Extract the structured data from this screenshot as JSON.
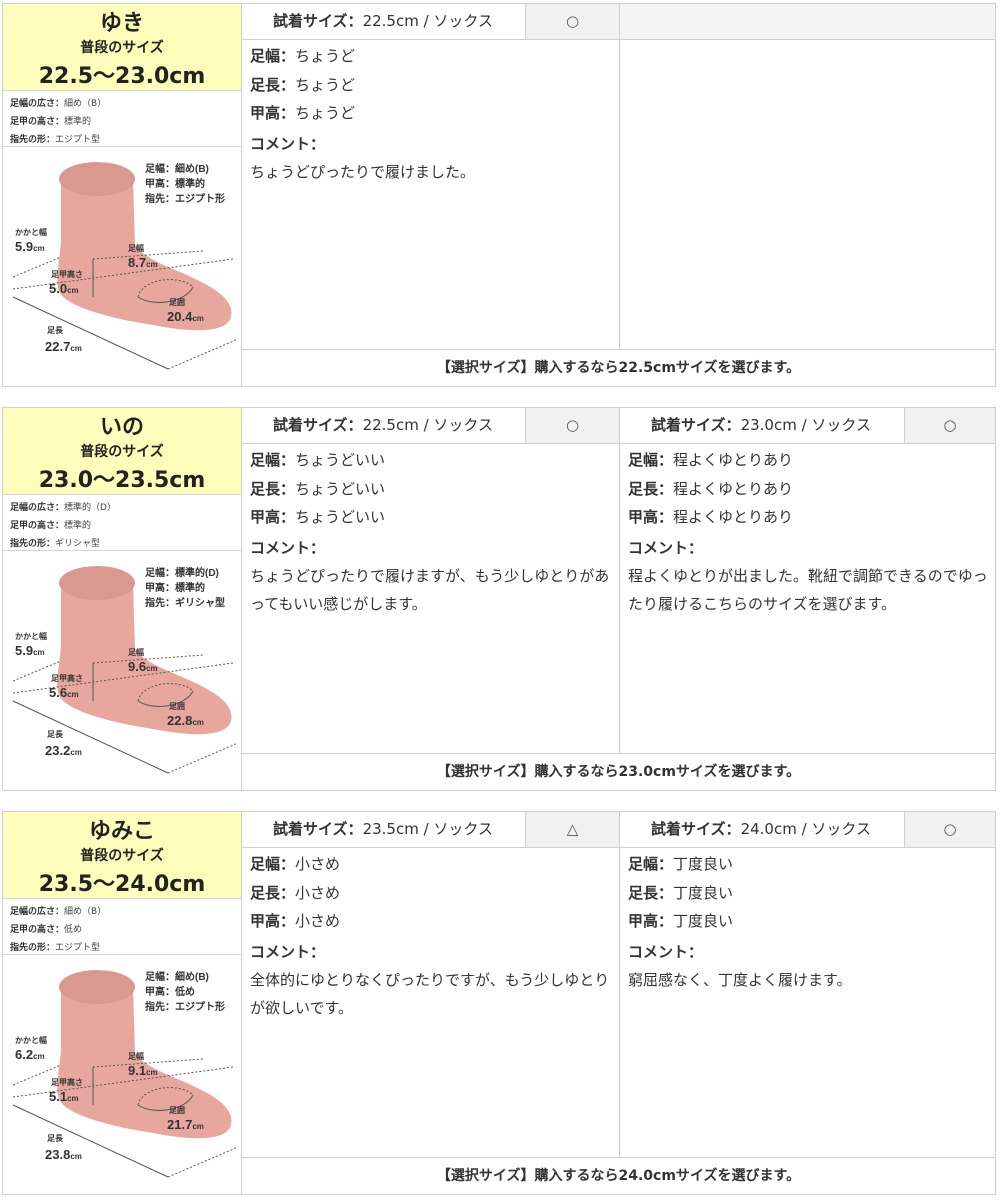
{
  "section_label": "普段のサイズ",
  "field_labels": {
    "size_label": "試着サイズ：",
    "width": "足幅：",
    "length": "足長：",
    "instep": "甲高：",
    "comment": "コメント："
  },
  "trait_labels": {
    "width": "足幅の広さ：",
    "instep": "足甲の高さ：",
    "toe": "指先の形："
  },
  "diagram_labels": {
    "heel": "かかと幅",
    "width": "足幅",
    "instep": "足甲高さ",
    "girth": "足囲",
    "length": "足長",
    "unit": "cm",
    "note_width": "足幅：",
    "note_instep": "甲高：",
    "note_toe": "指先："
  },
  "colors": {
    "highlight": "#fefdbb",
    "foot": "#e8a79e",
    "ankle": "#d99890"
  },
  "reviewers": [
    {
      "name": "ゆき",
      "usual_size": "22.5〜23.0cm",
      "traits": {
        "width": "細め（B）",
        "instep": "標準的",
        "toe": "エジプト型"
      },
      "diagram": {
        "note_width": "細め(B)",
        "note_instep": "標準的",
        "note_toe": "エジプト形",
        "heel": "5.9",
        "width": "8.7",
        "instep": "5.0",
        "girth": "20.4",
        "length": "22.7"
      },
      "fittings": [
        {
          "size": "22.5cm / ソックス",
          "rating": "○",
          "width": "ちょうど",
          "length": "ちょうど",
          "instep": "ちょうど",
          "comment": "ちょうどぴったりで履けました。"
        }
      ],
      "selection": "【選択サイズ】購入するなら22.5cmサイズを選びます。"
    },
    {
      "name": "いの",
      "usual_size": "23.0〜23.5cm",
      "traits": {
        "width": "標準的（D）",
        "instep": "標準的",
        "toe": "ギリシャ型"
      },
      "diagram": {
        "note_width": "標準的(D)",
        "note_instep": "標準的",
        "note_toe": "ギリシャ型",
        "heel": "5.9",
        "width": "9.6",
        "instep": "5.6",
        "girth": "22.8",
        "length": "23.2"
      },
      "fittings": [
        {
          "size": "22.5cm / ソックス",
          "rating": "○",
          "width": "ちょうどいい",
          "length": "ちょうどいい",
          "instep": "ちょうどいい",
          "comment_lines": [
            "ちょうどぴったりで履けますが、もう少しゆとりがあ",
            "ってもいい感じがします。"
          ]
        },
        {
          "size": "23.0cm / ソックス",
          "rating": "○",
          "width": "程よくゆとりあり",
          "length": "程よくゆとりあり",
          "instep": "程よくゆとりあり",
          "comment_lines": [
            "程よくゆとりが出ました。靴紐で調節できるのでゆっ",
            "たり履けるこちらのサイズを選びます。"
          ]
        }
      ],
      "selection": "【選択サイズ】購入するなら23.0cmサイズを選びます。"
    },
    {
      "name": "ゆみこ",
      "usual_size": "23.5〜24.0cm",
      "traits": {
        "width": "細め（B）",
        "instep": "低め",
        "toe": "エジプト型"
      },
      "diagram": {
        "note_width": "細め(B)",
        "note_instep": "低め",
        "note_toe": "エジプト形",
        "heel": "6.2",
        "width": "9.1",
        "instep": "5.1",
        "girth": "21.7",
        "length": "23.8"
      },
      "fittings": [
        {
          "size": "23.5cm / ソックス",
          "rating": "△",
          "width": "小さめ",
          "length": "小さめ",
          "instep": "小さめ",
          "comment_lines": [
            "全体的にゆとりなくぴったりですが、もう少しゆとり",
            "が欲しいです。"
          ]
        },
        {
          "size": "24.0cm / ソックス",
          "rating": "○",
          "width": "丁度良い",
          "length": "丁度良い",
          "instep": "丁度良い",
          "comment": "窮屈感なく、丁度よく履けます。"
        }
      ],
      "selection": "【選択サイズ】購入するなら24.0cmサイズを選びます。"
    }
  ]
}
